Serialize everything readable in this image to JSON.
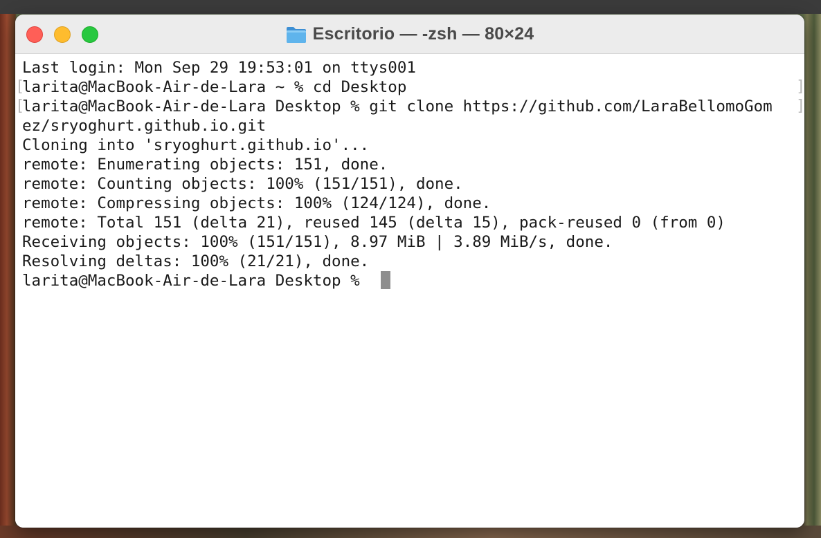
{
  "window": {
    "title": "Escritorio — -zsh — 80×24",
    "title_icon": "folder-icon",
    "controls": [
      "close",
      "minimize",
      "zoom"
    ]
  },
  "terminal": {
    "lines": [
      "Last login: Mon Sep 29 19:53:01 on ttys001",
      "larita@MacBook-Air-de-Lara ~ % cd Desktop",
      "larita@MacBook-Air-de-Lara Desktop % git clone https://github.com/LaraBellomoGom",
      "ez/sryoghurt.github.io.git",
      "Cloning into 'sryoghurt.github.io'...",
      "remote: Enumerating objects: 151, done.",
      "remote: Counting objects: 100% (151/151), done.",
      "remote: Compressing objects: 100% (124/124), done.",
      "remote: Total 151 (delta 21), reused 145 (delta 15), pack-reused 0 (from 0)",
      "Receiving objects: 100% (151/151), 8.97 MiB | 3.89 MiB/s, done.",
      "Resolving deltas: 100% (21/21), done.",
      "larita@MacBook-Air-de-Lara Desktop % "
    ],
    "cursor_color": "#8e8e8e"
  },
  "colors": {
    "close": "#ff5f57",
    "minimize": "#febc2e",
    "zoom": "#28c840",
    "folder": "#5aaee8"
  }
}
